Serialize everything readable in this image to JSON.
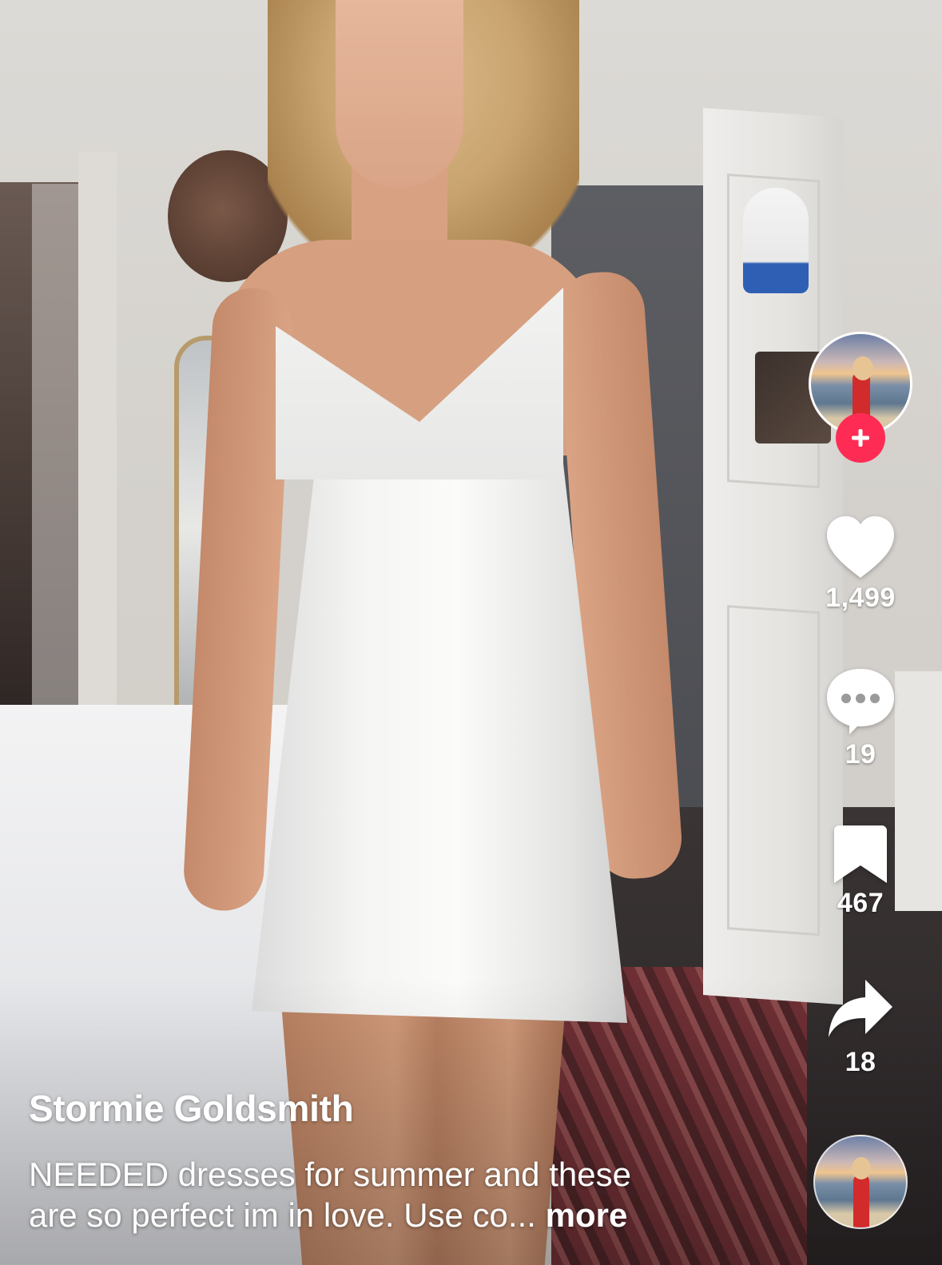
{
  "video": {
    "author": "Stormie Goldsmith",
    "caption_line1": "NEEDED dresses for summer and these",
    "caption_line2": "are so perfect im in love. Use co...",
    "more_label": "more"
  },
  "actions": {
    "likes": "1,499",
    "comments": "19",
    "saves": "467",
    "shares": "18"
  },
  "icons": {
    "follow": "plus-icon",
    "like": "heart-icon",
    "comment": "comment-bubble-icon",
    "save": "bookmark-icon",
    "share": "share-arrow-icon",
    "sound": "music-disc-icon"
  },
  "colors": {
    "follow_accent": "#fe2c55",
    "icon": "#ffffff"
  }
}
